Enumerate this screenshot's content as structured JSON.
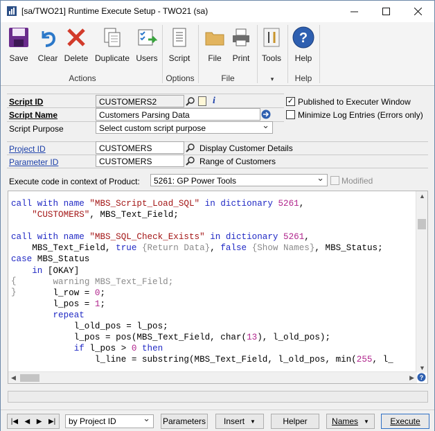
{
  "window": {
    "title": "[sa/TWO21] Runtime Execute Setup  -  TWO21 (sa)",
    "minimize_icon": "minimize-icon",
    "maximize_icon": "maximize-icon",
    "close_icon": "close-icon"
  },
  "ribbon": {
    "actions": {
      "label": "Actions",
      "save": "Save",
      "clear": "Clear",
      "delete": "Delete",
      "duplicate": "Duplicate",
      "users": "Users"
    },
    "options": {
      "label": "Options",
      "script": "Script"
    },
    "file": {
      "label": "File",
      "file": "File",
      "print": "Print"
    },
    "tools": {
      "tools": "Tools",
      "group_marker": "▾"
    },
    "help": {
      "label": "Help",
      "help": "Help"
    }
  },
  "form": {
    "script_id": {
      "label": "Script ID",
      "value": "CUSTOMERS2"
    },
    "script_name": {
      "label": "Script Name",
      "value": "Customers Parsing Data"
    },
    "script_purpose": {
      "label": "Script Purpose",
      "value": "Select custom script purpose"
    },
    "published": {
      "label": "Published to Executer Window",
      "checked": true
    },
    "minimize_log": {
      "label": "Minimize Log Entries (Errors only)",
      "checked": false
    },
    "project_id": {
      "label": "Project ID",
      "value": "CUSTOMERS",
      "description": "Display Customer Details"
    },
    "parameter_id": {
      "label": "Parameter ID",
      "value": "CUSTOMERS",
      "description": "Range of Customers"
    },
    "product": {
      "label": "Execute code in context of Product:",
      "value": "5261: GP Power Tools"
    },
    "modified": {
      "label": "Modified",
      "checked": false
    }
  },
  "editor": {
    "gutter": [
      "{",
      "}"
    ],
    "lines": [
      "call with name \"MBS_Script_Load_SQL\" in dictionary 5261,",
      "    \"CUSTOMERS\", MBS_Text_Field;",
      "",
      "call with name \"MBS_SQL_Check_Exists\" in dictionary 5261,",
      "    MBS_Text_Field, true {Return Data}, false {Show Names}, MBS_Status;",
      "case MBS_Status",
      "    in [OKAY]",
      "        warning MBS_Text_Field;",
      "        l_row = 0;",
      "        l_pos = 1;",
      "        repeat",
      "            l_old_pos = l_pos;",
      "            l_pos = pos(MBS_Text_Field, char(13), l_old_pos);",
      "            if l_pos > 0 then",
      "                l_line = substring(MBS_Text_Field, l_old_pos, min(255, l_"
    ]
  },
  "bottom": {
    "sort_by": "by Project ID",
    "parameters": "Parameters",
    "insert": "Insert",
    "helper": "Helper",
    "names": "Names",
    "execute": "Execute"
  },
  "colors": {
    "keyword": "#1f28c4",
    "string": "#a31515",
    "number": "#b0248c",
    "comment": "#8a8a8a",
    "link": "#1b3fa8"
  }
}
